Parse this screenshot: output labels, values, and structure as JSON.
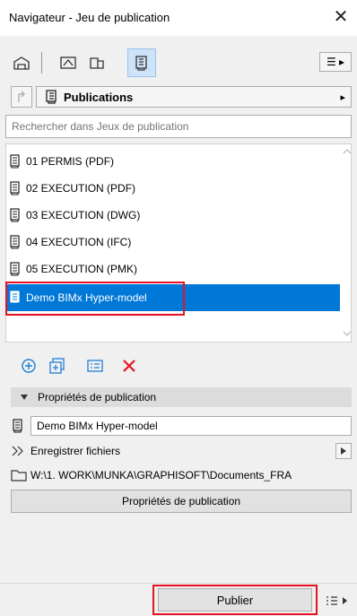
{
  "window": {
    "title": "Navigateur - Jeu de publication",
    "close_glyph": "✕"
  },
  "toolbar": {
    "menu_glyph": "☰ ▸"
  },
  "nav": {
    "folder_label": "Publications",
    "arrow_glyph": "▸"
  },
  "search": {
    "placeholder": "Rechercher dans Jeux de publication"
  },
  "publication_sets": [
    {
      "label": "01 PERMIS (PDF)",
      "selected": false
    },
    {
      "label": "02 EXECUTION (PDF)",
      "selected": false
    },
    {
      "label": "03 EXECUTION (DWG)",
      "selected": false
    },
    {
      "label": "04 EXECUTION (IFC)",
      "selected": false
    },
    {
      "label": "05 EXECUTION (PMK)",
      "selected": false
    },
    {
      "label": "Demo BIMx Hyper-model",
      "selected": true
    }
  ],
  "properties": {
    "header": "Propriétés de publication",
    "name_value": "Demo BIMx Hyper-model",
    "save_files_label": "Enregistrer fichiers",
    "path": "W:\\1. WORK\\MUNKA\\GRAPHISOFT\\Documents_FRA",
    "settings_button": "Propriétés de publication"
  },
  "footer": {
    "publish_button": "Publier"
  },
  "colors": {
    "selection": "#0078d7",
    "highlight_box": "#e81123",
    "delete": "#e81123",
    "action_icons": "#1e7fd6"
  }
}
